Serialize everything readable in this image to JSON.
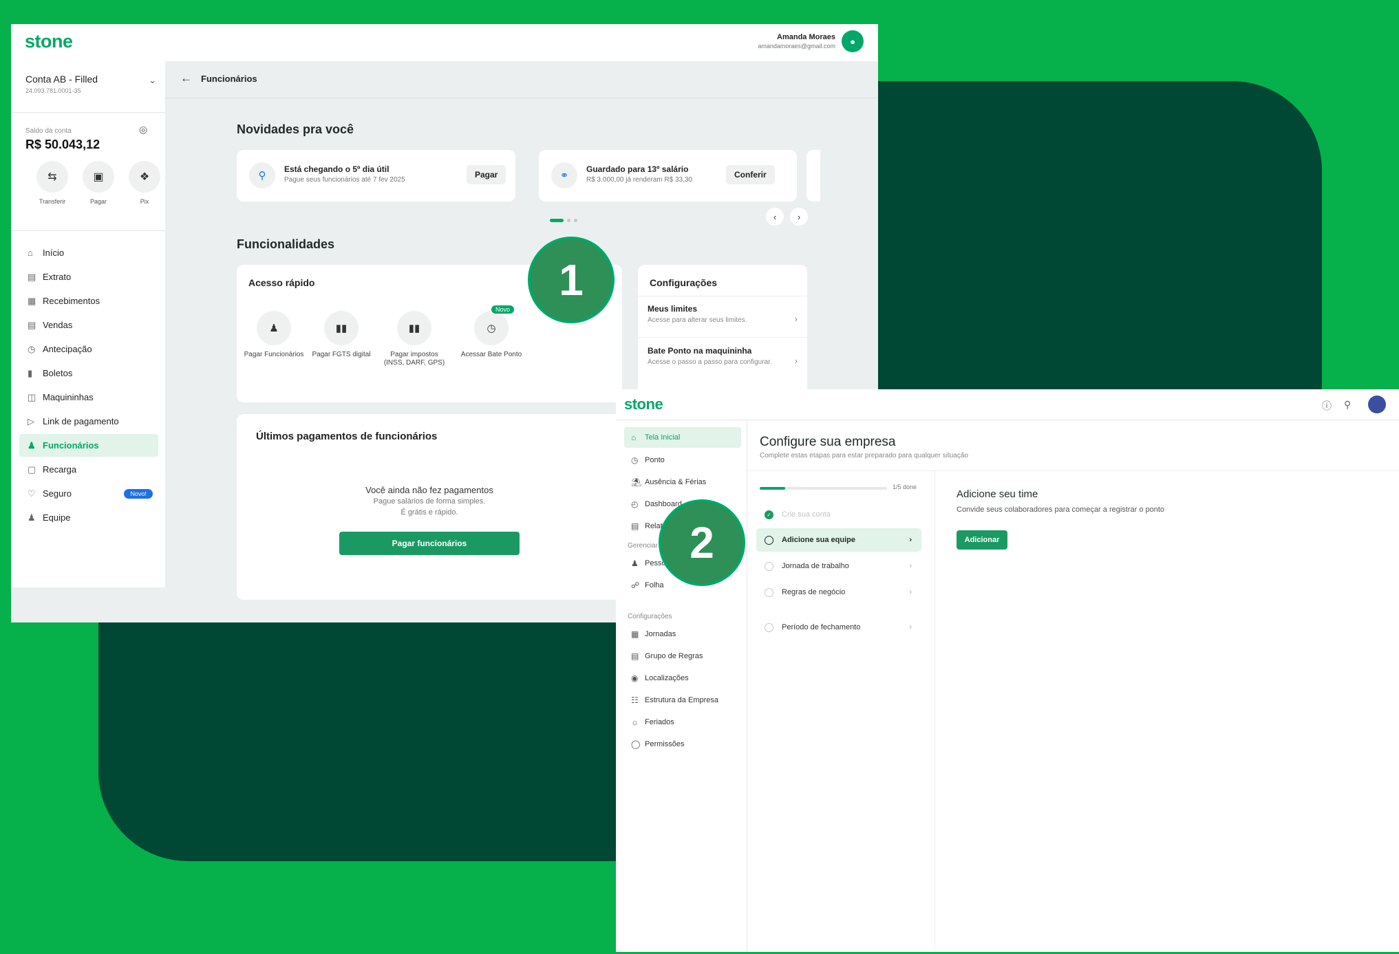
{
  "colors": {
    "page_bg": "#06b04a",
    "dark_green": "#004734",
    "accent": "#00a868",
    "primary_button": "#1a9a62",
    "badge_blue": "#1f6fe5"
  },
  "window1": {
    "logo": "stone",
    "user": {
      "name": "Amanda Moraes",
      "email": "amandamoraes@gmail.com",
      "avatar_icon": "person-icon"
    },
    "account": {
      "name": "Conta AB - Filled",
      "document": "24.093.781.0001-35"
    },
    "balance": {
      "label": "Saldo da conta",
      "value": "R$ 50.043,12"
    },
    "quick_actions": [
      {
        "label": "Transferir",
        "icon": "transfer-icon"
      },
      {
        "label": "Pagar",
        "icon": "barcode-scan-icon"
      },
      {
        "label": "Pix",
        "icon": "pix-icon"
      }
    ],
    "nav": [
      {
        "label": "Início",
        "icon": "home-icon"
      },
      {
        "label": "Extrato",
        "icon": "statement-icon"
      },
      {
        "label": "Recebimentos",
        "icon": "calendar-icon"
      },
      {
        "label": "Vendas",
        "icon": "store-icon"
      },
      {
        "label": "Antecipação",
        "icon": "clock-icon"
      },
      {
        "label": "Boletos",
        "icon": "barcode-icon"
      },
      {
        "label": "Maquininhas",
        "icon": "card-machine-icon"
      },
      {
        "label": "Link de pagamento",
        "icon": "link-icon"
      },
      {
        "label": "Funcionários",
        "icon": "people-icon",
        "active": true
      },
      {
        "label": "Recarga",
        "icon": "phone-icon"
      },
      {
        "label": "Seguro",
        "icon": "heart-icon",
        "badge": "Novo!"
      },
      {
        "label": "Equipe",
        "icon": "team-icon"
      }
    ],
    "breadcrumb_title": "Funcionários",
    "news": {
      "heading": "Novidades pra você",
      "cards": [
        {
          "title": "Está chegando o 5º dia útil",
          "subtitle": "Pague seus funcionários até 7 fev 2025",
          "button": "Pagar",
          "icon": "bell-icon"
        },
        {
          "title": "Guardado para 13º salário",
          "subtitle": "R$ 3.000,00 já renderam R$ 33,30",
          "button": "Conferir",
          "icon": "piggy-bank-icon"
        }
      ]
    },
    "features": {
      "heading": "Funcionalidades",
      "quick_access": {
        "title": "Acesso rápido",
        "items": [
          {
            "label": "Pagar Funcionários",
            "icon": "people-icon"
          },
          {
            "label": "Pagar FGTS digital",
            "icon": "barcode-icon"
          },
          {
            "label": "Pagar impostos (INSS, DARF, GPS)",
            "icon": "barcode-icon"
          },
          {
            "label": "Acessar Bate Ponto",
            "icon": "clock-in-icon",
            "badge": "Novo"
          }
        ]
      },
      "settings": {
        "title": "Configurações",
        "items": [
          {
            "title": "Meus limites",
            "subtitle": "Acesse para alterar seus limites."
          },
          {
            "title": "Bate Ponto na maquininha",
            "subtitle": "Acesse o passo a passo para configurar."
          }
        ]
      }
    },
    "last_payments": {
      "title": "Últimos pagamentos de funcionários",
      "empty_title": "Você ainda não fez pagamentos",
      "empty_line1": "Pague salários de forma simples.",
      "empty_line2": "É grátis e rápido.",
      "button": "Pagar funcionários"
    }
  },
  "step_markers": [
    "1",
    "2"
  ],
  "window2": {
    "logo": "stone",
    "top_icons": [
      "help-icon",
      "bell-icon"
    ],
    "nav_main": [
      {
        "label": "Tela Inicial",
        "icon": "home-icon",
        "active": true
      },
      {
        "label": "Ponto",
        "icon": "clock-icon"
      },
      {
        "label": "Ausência & Férias",
        "icon": "beach-icon"
      },
      {
        "label": "Dashboard",
        "icon": "dashboard-icon"
      },
      {
        "label": "Relatórios",
        "icon": "report-icon"
      }
    ],
    "group_manage": "Gerenciar",
    "nav_manage": [
      {
        "label": "Pessoas",
        "icon": "people-icon"
      },
      {
        "label": "Folha",
        "icon": "payroll-icon"
      }
    ],
    "group_settings": "Configurações",
    "nav_settings": [
      {
        "label": "Jornadas",
        "icon": "calendar-icon"
      },
      {
        "label": "Grupo de Regras",
        "icon": "rules-icon"
      },
      {
        "label": "Localizações",
        "icon": "pin-icon"
      },
      {
        "label": "Estrutura da Empresa",
        "icon": "org-icon"
      },
      {
        "label": "Feriados",
        "icon": "sun-icon"
      },
      {
        "label": "Permissões",
        "icon": "shield-icon"
      }
    ],
    "title": "Configure sua empresa",
    "subtitle": "Complete estas etapas para estar preparado para qualquer situação",
    "progress": {
      "label": "1/5 done",
      "fraction": 0.2
    },
    "steps": [
      {
        "label": "Crie sua conta",
        "state": "done"
      },
      {
        "label": "Adicione sua equipe",
        "state": "active"
      },
      {
        "label": "Jornada de trabalho",
        "state": "todo"
      },
      {
        "label": "Regras de negócio",
        "state": "todo"
      },
      {
        "label": "Período de fechamento",
        "state": "todo"
      }
    ],
    "panel": {
      "title": "Adicione seu time",
      "text": "Convide seus colaboradores para começar a registrar o ponto",
      "button": "Adicionar"
    }
  }
}
